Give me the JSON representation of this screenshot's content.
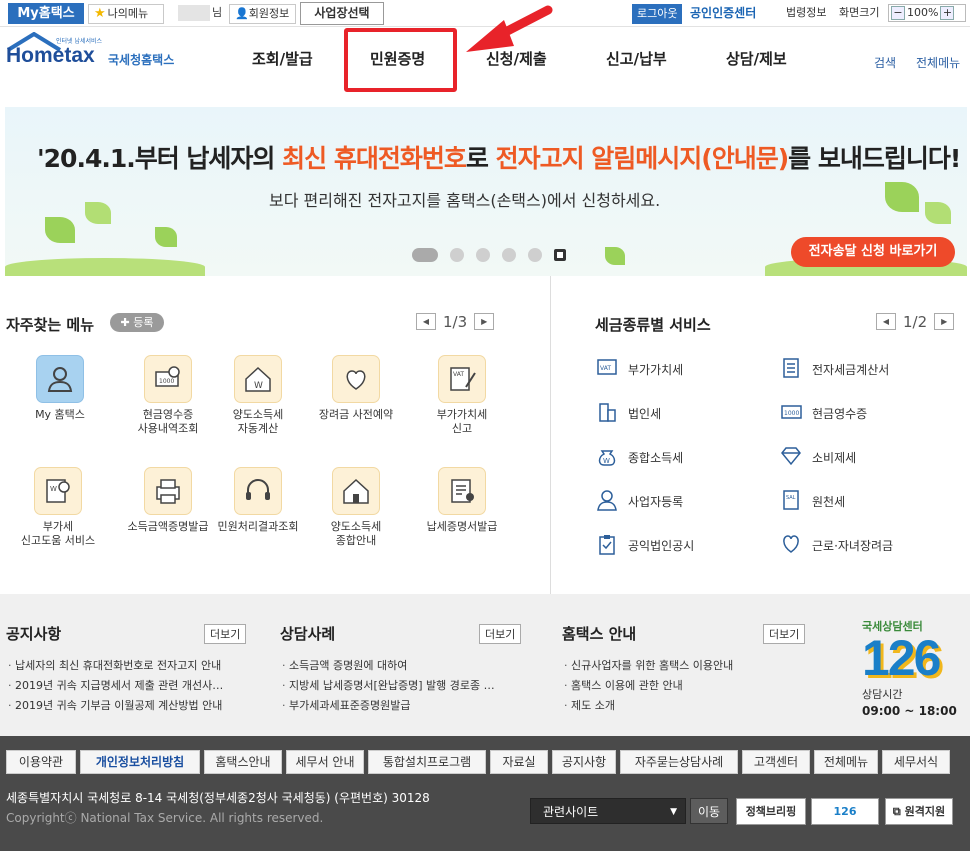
{
  "topbar": {
    "myhome": "My홈택스",
    "mymenu": "나의메뉴",
    "user_suffix": "님",
    "member_info": "회원정보",
    "biz_select": "사업장선택",
    "logout": "로그아웃",
    "cert_center": "공인인증센터",
    "law_info": "법령정보",
    "screen_size": "화면크기",
    "zoom": "100%"
  },
  "header": {
    "logo_small": "인터넷 납세서비스",
    "logo_main": "Hometax",
    "logo_korean": "국세청홈택스",
    "nav": [
      "조회/발급",
      "민원증명",
      "신청/제출",
      "신고/납부",
      "상담/제보"
    ],
    "search": "검색",
    "all_menu": "전체메뉴"
  },
  "banner": {
    "line1_a": "'20.4.1.부터 납세자의 ",
    "line1_b": "최신 휴대전화번호",
    "line1_c": "로 ",
    "line1_d": "전자고지 알림메시지(안내문)",
    "line1_e": "를 보내드립니다!",
    "line2": "보다 편리해진 전자고지를 홈택스(손택스)에서 신청하세요.",
    "cta": "전자송달 신청 바로가기"
  },
  "favorites": {
    "title": "자주찾는 메뉴",
    "register": "등록",
    "page": "1/3",
    "items": [
      {
        "label": "My 홈택스",
        "icon": "user-icon"
      },
      {
        "label": "현금영수증\n사용내역조회",
        "icon": "receipt-search-icon"
      },
      {
        "label": "양도소득세\n자동계산",
        "icon": "house-won-icon"
      },
      {
        "label": "장려금 사전예약",
        "icon": "heart-hand-icon"
      },
      {
        "label": "부가가치세\n신고",
        "icon": "vat-document-icon"
      },
      {
        "label": "부가세\n신고도움 서비스",
        "icon": "document-search-icon"
      },
      {
        "label": "소득금액증명발급",
        "icon": "printer-icon"
      },
      {
        "label": "민원처리결과조회",
        "icon": "headset-icon"
      },
      {
        "label": "양도소득세\n종합안내",
        "icon": "house-pen-icon"
      },
      {
        "label": "납세증명서발급",
        "icon": "certificate-icon"
      }
    ]
  },
  "taxservice": {
    "title": "세금종류별 서비스",
    "page": "1/2",
    "items": [
      {
        "label": "부가가치세",
        "icon": "vat-icon"
      },
      {
        "label": "전자세금계산서",
        "icon": "invoice-icon"
      },
      {
        "label": "법인세",
        "icon": "building-icon"
      },
      {
        "label": "현금영수증",
        "icon": "cash-receipt-icon"
      },
      {
        "label": "종합소득세",
        "icon": "money-bag-icon"
      },
      {
        "label": "소비제세",
        "icon": "diamond-icon"
      },
      {
        "label": "사업자등록",
        "icon": "person-icon"
      },
      {
        "label": "원천세",
        "icon": "salary-icon"
      },
      {
        "label": "공익법인공시",
        "icon": "clipboard-icon"
      },
      {
        "label": "근로·자녀장려금",
        "icon": "heart-icon"
      }
    ]
  },
  "notices": {
    "more": "더보기",
    "cols": [
      {
        "title": "공지사항",
        "items": [
          "납세자의 최신 휴대전화번호로 전자고지 안내",
          "2019년 귀속 지급명세서 제출 관련 개선사…",
          "2019년 귀속 기부금 이월공제 계산방법 안내"
        ]
      },
      {
        "title": "상담사례",
        "items": [
          "소득금액 증명원에 대하여",
          "지방세 납세증명서[완납증명] 발행 경로종 …",
          "부가세과세표준증명원발급"
        ]
      },
      {
        "title": "홈택스 안내",
        "items": [
          "신규사업자를 위한 홈택스 이용안내",
          "홈택스 이용에 관한 안내",
          "제도 소개"
        ]
      }
    ]
  },
  "center126": {
    "label": "국세상담센터",
    "number": "126",
    "hours_label": "상담시간",
    "hours": "09:00 ~ 18:00"
  },
  "footer": {
    "links": [
      "이용약관",
      "개인정보처리방침",
      "홈택스안내",
      "세무서 안내",
      "통합설치프로그램",
      "자료실",
      "공지사항",
      "자주묻는상담사례",
      "고객센터",
      "전체메뉴",
      "세무서식"
    ],
    "address": "세종특별자치시 국세청로 8-14 국세청(정부세종2청사 국세청동) (우편번호) 30128",
    "copyright": "Copyrightⓒ National Tax Service. All rights reserved.",
    "related_site": "관련사이트",
    "go": "이동",
    "briefing": "정책브리핑",
    "center126_btn": "126",
    "remote": "원격지원"
  },
  "colors": {
    "blue": "#2b6fbd",
    "orange": "#ee5a24",
    "red": "#e8232a",
    "footer": "#4a4a4a"
  }
}
